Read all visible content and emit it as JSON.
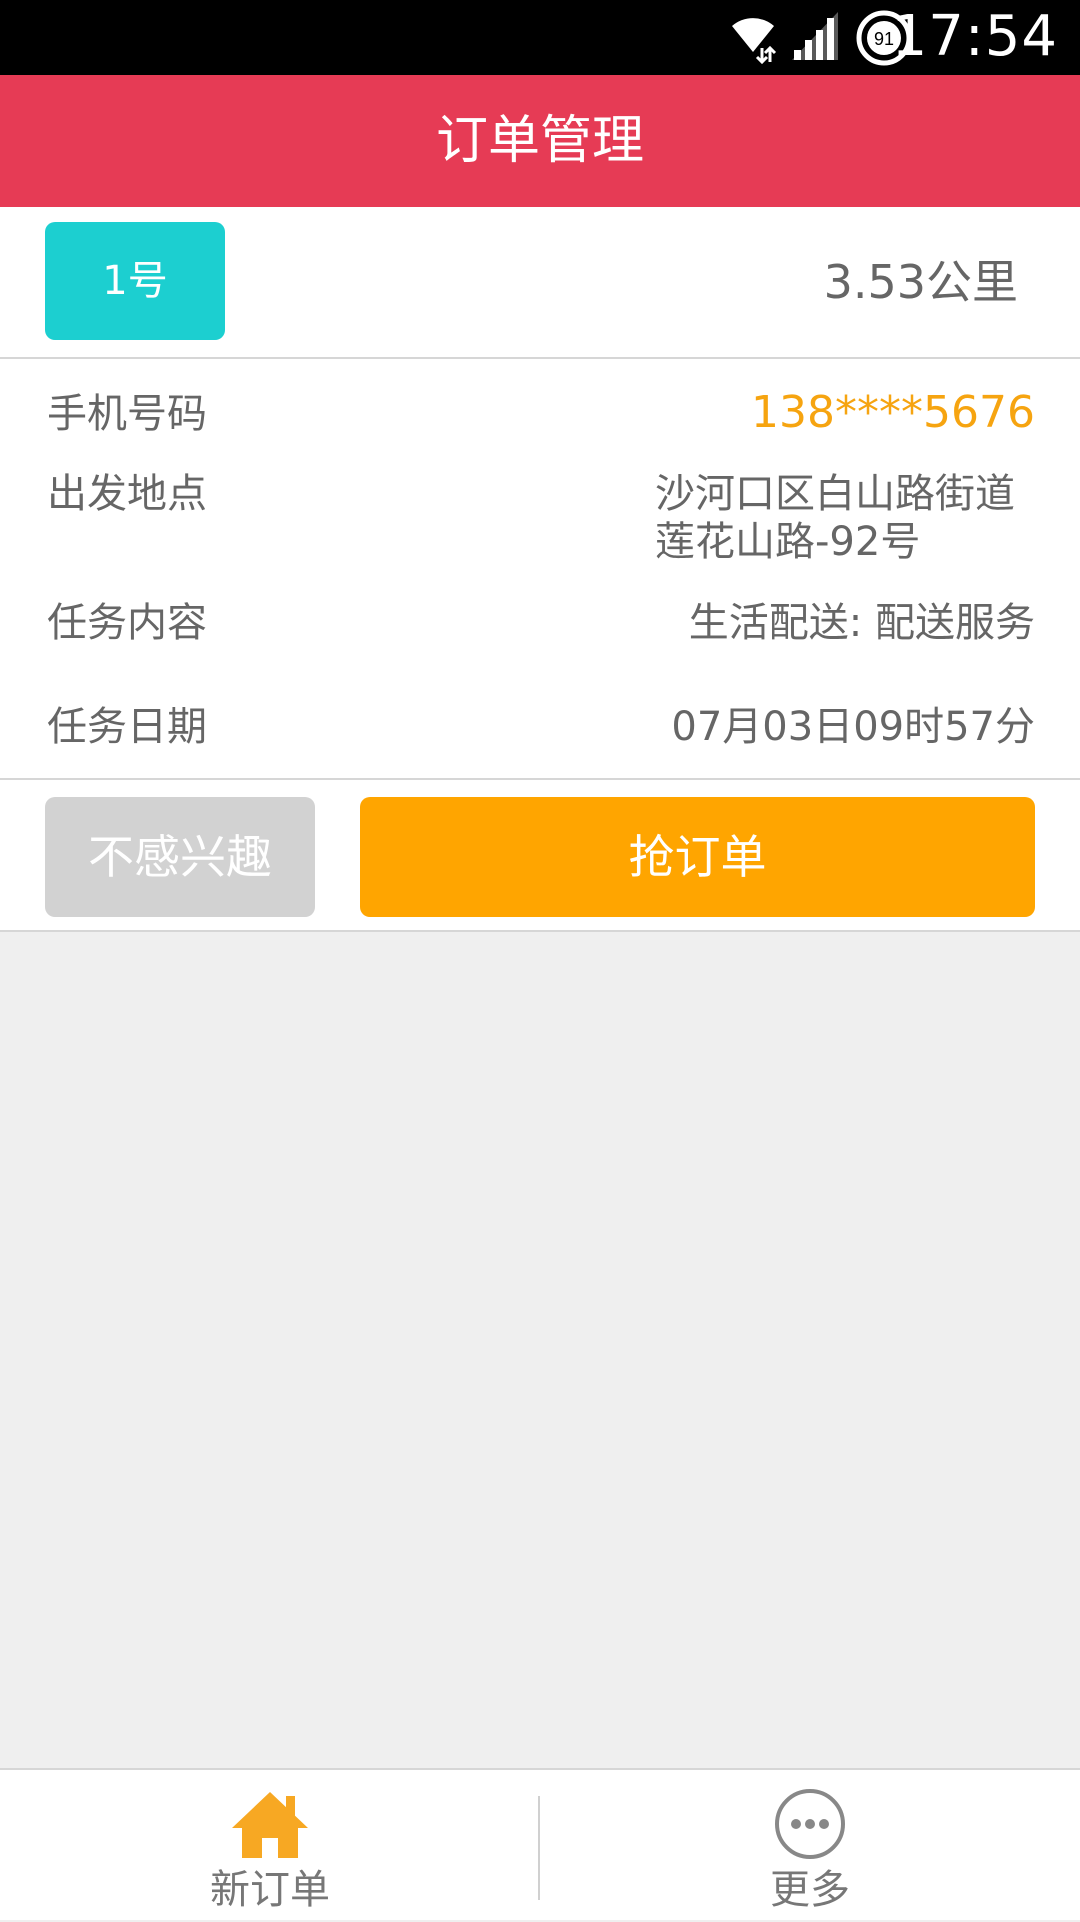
{
  "status_bar": {
    "time": "17:54",
    "battery_level": "91",
    "icons": [
      "wifi-icon",
      "signal-icon",
      "battery-icon"
    ]
  },
  "header": {
    "title": "订单管理"
  },
  "order": {
    "badge": "1号",
    "distance": "3.53公里",
    "rows": [
      {
        "label": "手机号码",
        "value": "138****5676"
      },
      {
        "label": "出发地点",
        "value_line1": "沙河口区白山路街道",
        "value_line2": "莲花山路-92号"
      },
      {
        "label": "任务内容",
        "value": "生活配送: 配送服务"
      },
      {
        "label": "任务日期",
        "value": "07月03日09时57分"
      }
    ],
    "buttons": {
      "skip": "不感兴趣",
      "grab": "抢订单"
    }
  },
  "tabs": [
    {
      "label": "新订单",
      "icon": "home-icon",
      "active": true
    },
    {
      "label": "更多",
      "icon": "more-icon",
      "active": false
    }
  ],
  "colors": {
    "header": "#e63b55",
    "badge": "#1ccfd0",
    "accent": "#ffa500",
    "phone": "#f6a410",
    "disabled_button": "#d2d2d2"
  }
}
